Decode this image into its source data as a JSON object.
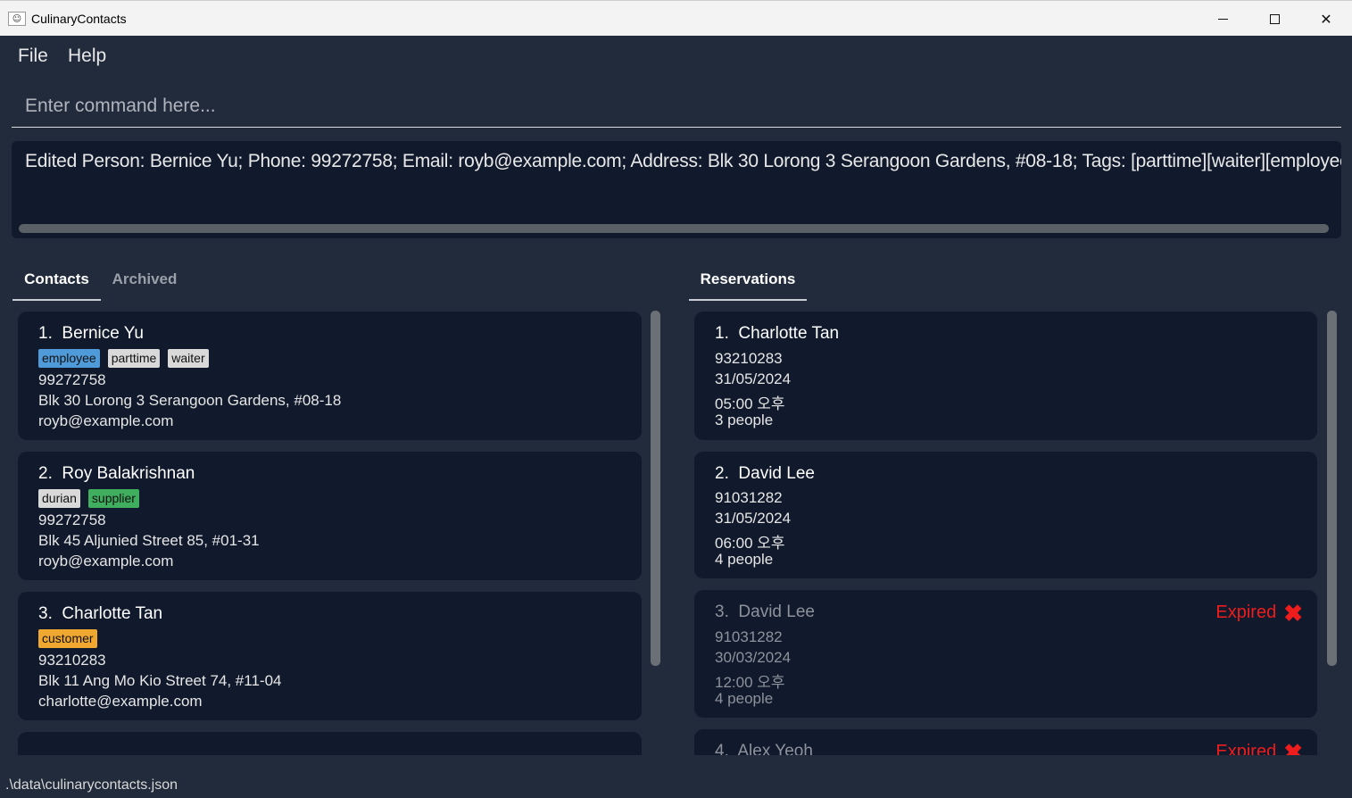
{
  "window": {
    "title": "CulinaryContacts",
    "app_icon": "duke-icon"
  },
  "menu": {
    "file": "File",
    "help": "Help"
  },
  "command": {
    "placeholder": "Enter command here..."
  },
  "result": {
    "text": "Edited Person: Bernice Yu; Phone: 99272758; Email: royb@example.com; Address: Blk 30 Lorong 3 Serangoon Gardens, #08-18; Tags: [parttime][waiter][employee]"
  },
  "tabs": {
    "contacts": "Contacts",
    "archived": "Archived",
    "reservations": "Reservations"
  },
  "tag_colors": {
    "employee": "#4f9bd9",
    "parttime": "#d9d9d9",
    "waiter": "#d9d9d9",
    "durian": "#d9d9d9",
    "supplier": "#3fae5f",
    "customer": "#f0a830"
  },
  "contacts": [
    {
      "index": "1.",
      "name": "Bernice Yu",
      "tags": [
        "employee",
        "parttime",
        "waiter"
      ],
      "phone": "99272758",
      "address": "Blk 30 Lorong 3 Serangoon Gardens, #08-18",
      "email": "royb@example.com"
    },
    {
      "index": "2.",
      "name": "Roy Balakrishnan",
      "tags": [
        "durian",
        "supplier"
      ],
      "phone": "99272758",
      "address": "Blk 45 Aljunied Street 85, #01-31",
      "email": "royb@example.com"
    },
    {
      "index": "3.",
      "name": "Charlotte Tan",
      "tags": [
        "customer"
      ],
      "phone": "93210283",
      "address": "Blk 11 Ang Mo Kio Street 74, #11-04",
      "email": "charlotte@example.com"
    }
  ],
  "reservations": [
    {
      "index": "1.",
      "name": "Charlotte Tan",
      "phone": "93210283",
      "date": "31/05/2024",
      "time": "05:00 오후",
      "people": "3 people",
      "expired": false
    },
    {
      "index": "2.",
      "name": "David Lee",
      "phone": "91031282",
      "date": "31/05/2024",
      "time": "06:00 오후",
      "people": "4 people",
      "expired": false
    },
    {
      "index": "3.",
      "name": "David Lee",
      "phone": "91031282",
      "date": "30/03/2024",
      "time": "12:00 오후",
      "people": "4 people",
      "expired": true
    },
    {
      "index": "4.",
      "name": "Alex Yeoh",
      "phone": "",
      "date": "",
      "time": "",
      "people": "",
      "expired": true
    }
  ],
  "expired_label": "Expired",
  "status": {
    "path": ".\\data\\culinarycontacts.json"
  }
}
